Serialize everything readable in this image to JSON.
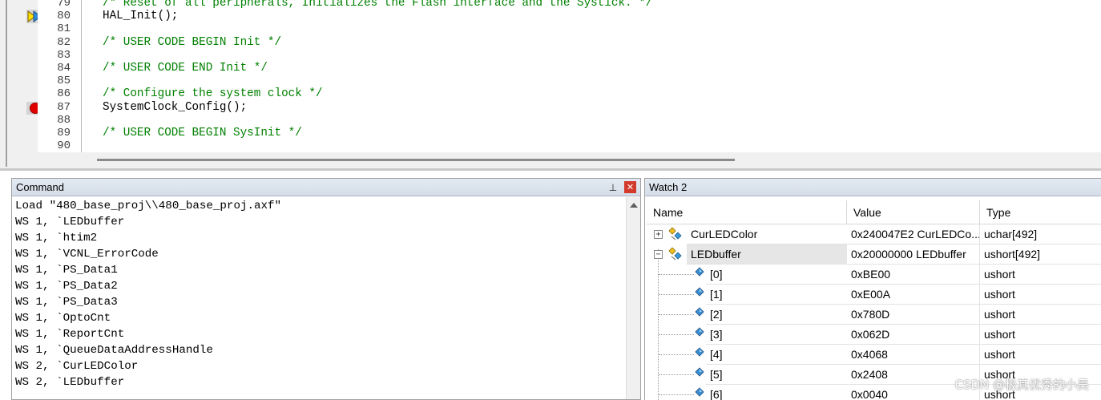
{
  "editor": {
    "lines": [
      {
        "num": "79",
        "text": "/* Reset of all peripherals, Initializes the Flash interface and the Systick. */",
        "kind": "comment"
      },
      {
        "num": "80",
        "text": "HAL_Init();",
        "kind": "normal"
      },
      {
        "num": "81",
        "text": "",
        "kind": "normal"
      },
      {
        "num": "82",
        "text": "/* USER CODE BEGIN Init */",
        "kind": "comment"
      },
      {
        "num": "83",
        "text": "",
        "kind": "normal"
      },
      {
        "num": "84",
        "text": "/* USER CODE END Init */",
        "kind": "comment"
      },
      {
        "num": "85",
        "text": "",
        "kind": "normal"
      },
      {
        "num": "86",
        "text": "/* Configure the system clock */",
        "kind": "comment"
      },
      {
        "num": "87",
        "text": "SystemClock_Config();",
        "kind": "normal"
      },
      {
        "num": "88",
        "text": "",
        "kind": "normal"
      },
      {
        "num": "89",
        "text": "/* USER CODE BEGIN SysInit */",
        "kind": "comment"
      },
      {
        "num": "90",
        "text": "",
        "kind": "normal"
      }
    ],
    "current_line": "80",
    "breakpoint_line": "87",
    "icons": {
      "current": "execution-arrow-icon",
      "breakpoint": "breakpoint-icon"
    }
  },
  "command": {
    "title": "Command",
    "lines": [
      "Load \"480_base_proj\\\\480_base_proj.axf\"",
      "WS 1, `LEDbuffer",
      "WS 1, `htim2",
      "WS 1, `VCNL_ErrorCode",
      "WS 1, `PS_Data1",
      "WS 1, `PS_Data2",
      "WS 1, `PS_Data3",
      "WS 1, `OptoCnt",
      "WS 1, `ReportCnt",
      "WS 1, `QueueDataAddressHandle",
      "WS 2, `CurLEDColor",
      "WS 2, `LEDbuffer"
    ]
  },
  "watch": {
    "title": "Watch 2",
    "columns": {
      "name": "Name",
      "value": "Value",
      "type": "Type"
    },
    "rows": [
      {
        "name": "CurLEDColor",
        "value": "0x240047E2 CurLEDCo...",
        "type": "uchar[492]",
        "expander": "+",
        "selected": false
      },
      {
        "name": "LEDbuffer",
        "value": "0x20000000 LEDbuffer",
        "type": "ushort[492]",
        "expander": "−",
        "selected": true
      },
      {
        "name": "[0]",
        "value": "0xBE00",
        "type": "ushort"
      },
      {
        "name": "[1]",
        "value": "0xE00A",
        "type": "ushort"
      },
      {
        "name": "[2]",
        "value": "0x780D",
        "type": "ushort"
      },
      {
        "name": "[3]",
        "value": "0x062D",
        "type": "ushort"
      },
      {
        "name": "[4]",
        "value": "0x4068",
        "type": "ushort"
      },
      {
        "name": "[5]",
        "value": "0x2408",
        "type": "ushort"
      },
      {
        "name": "[6]",
        "value": "0x0040",
        "type": "ushort"
      }
    ]
  },
  "watermark": "CSDN @极其优秀的小吴",
  "colors": {
    "comment": "#008000",
    "breakpoint": "#e00000",
    "title_bar": "#dde5ee",
    "close": "#d33a2c"
  }
}
